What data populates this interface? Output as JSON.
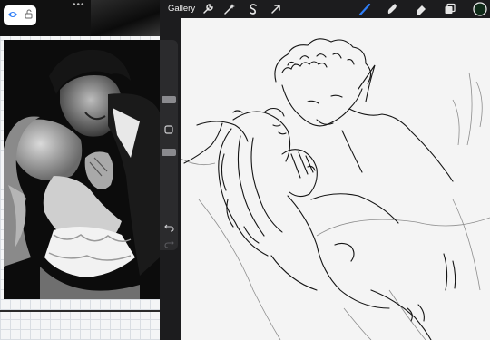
{
  "toolbar": {
    "gallery_label": "Gallery",
    "left_tools": [
      "wrench-icon",
      "magic-wand-icon",
      "selection-s-icon",
      "transform-arrow-icon"
    ],
    "right_tools": [
      "brush-icon",
      "smudge-icon",
      "eraser-icon",
      "layers-icon"
    ],
    "active_tool": "brush-icon",
    "active_color": "#0f2a18",
    "accent_color": "#2f7ef7"
  },
  "reference_panel": {
    "grabber_glyph": "•••",
    "visibility_icon": "eye-icon",
    "lock_icon": "lock-open-icon"
  },
  "sidebar": {
    "buttons": [
      "square-modify-icon",
      "undo-icon",
      "redo-icon"
    ]
  }
}
